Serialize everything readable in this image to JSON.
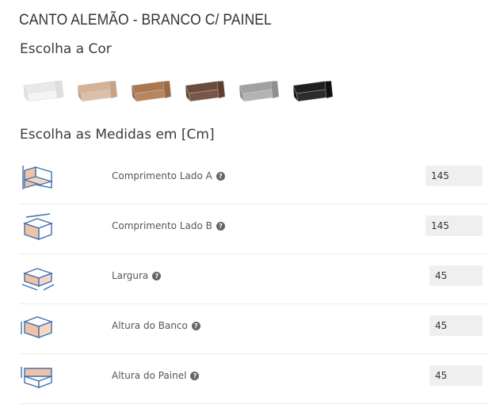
{
  "product": {
    "title": "CANTO ALEMÃO - BRANCO C/ PAINEL"
  },
  "color_section": {
    "heading": "Escolha a Cor",
    "swatches": [
      {
        "name": "branco",
        "seat": "#f4f4f4",
        "side": "#dedede",
        "back": "#e9e9e9"
      },
      {
        "name": "bege",
        "seat": "#ddbfa6",
        "side": "#c7a284",
        "back": "#d4b297"
      },
      {
        "name": "carvalho",
        "seat": "#b9855f",
        "side": "#9a6a46",
        "back": "#aa7752"
      },
      {
        "name": "tabaco",
        "seat": "#7a5646",
        "side": "#5e3f31",
        "back": "#6b4b3c"
      },
      {
        "name": "cinza",
        "seat": "#b3b3b3",
        "side": "#8f8f8f",
        "back": "#a1a1a1"
      },
      {
        "name": "preto",
        "seat": "#2c2c2c",
        "side": "#111111",
        "back": "#1f1f1f"
      }
    ]
  },
  "measures_section": {
    "heading": "Escolha as Medidas em [Cm]",
    "rows": [
      {
        "label": "Comprimento Lado A",
        "value": "145",
        "icon": "side-a-diagram-icon"
      },
      {
        "label": "Comprimento Lado B",
        "value": "145",
        "icon": "side-b-diagram-icon"
      },
      {
        "label": "Largura",
        "value": "45",
        "icon": "width-diagram-icon"
      },
      {
        "label": "Altura do Banco",
        "value": "45",
        "icon": "seat-height-diagram-icon"
      },
      {
        "label": "Altura do Painel",
        "value": "45",
        "icon": "panel-height-diagram-icon"
      }
    ],
    "help_glyph": "?"
  }
}
